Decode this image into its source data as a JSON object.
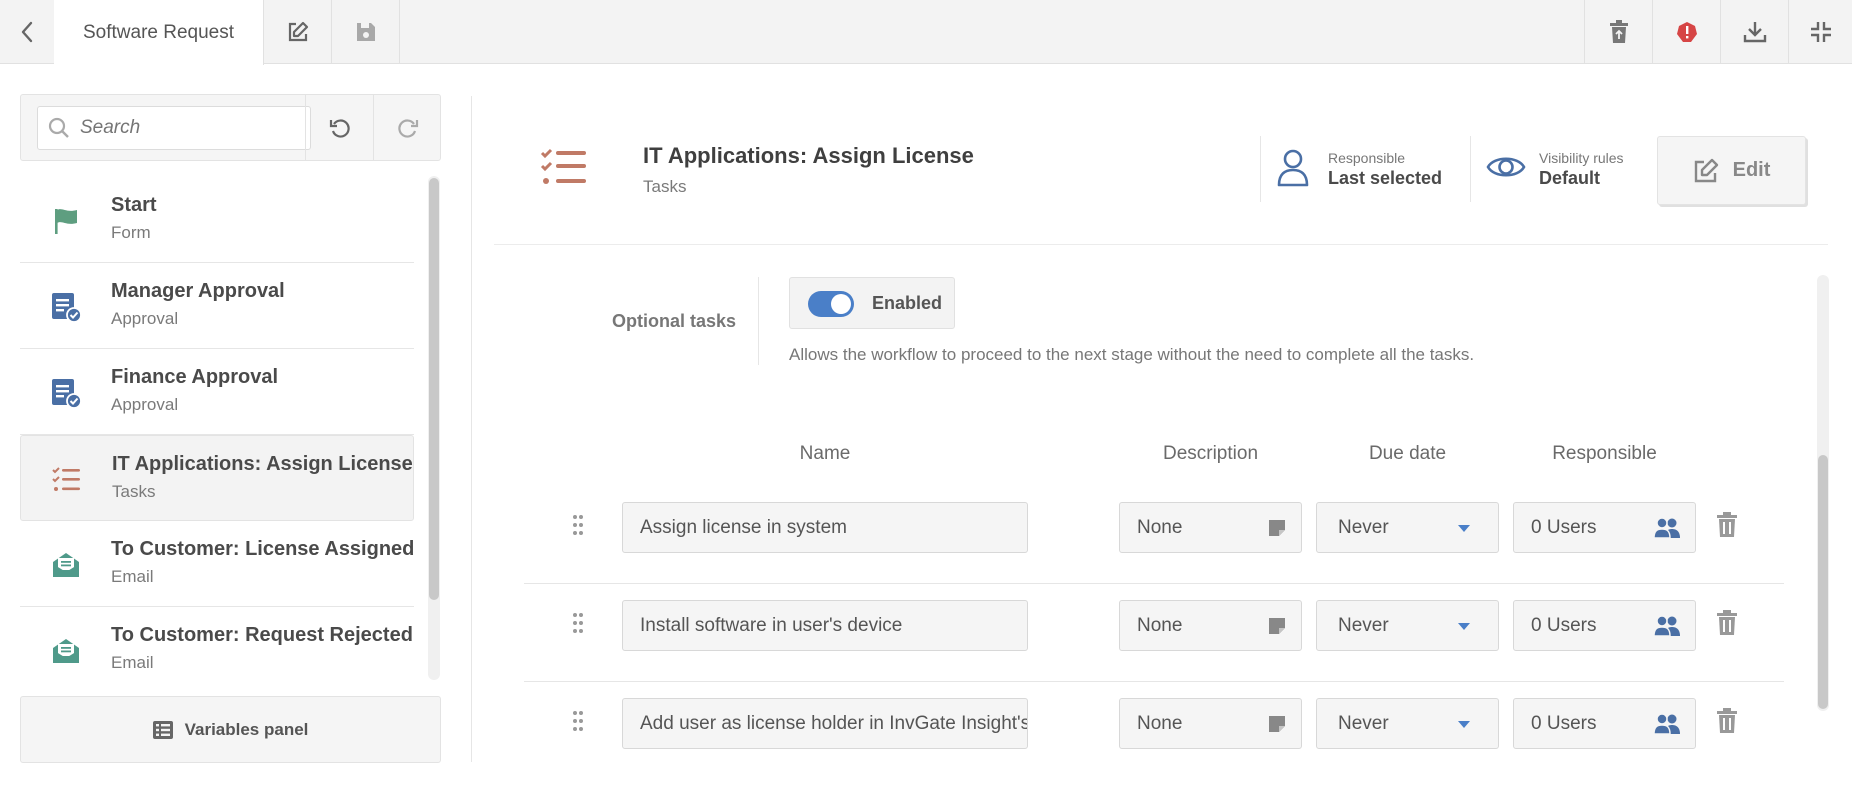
{
  "topbar": {
    "tab_title": "Software Request"
  },
  "search": {
    "placeholder": "Search"
  },
  "stages": [
    {
      "name": "Start",
      "type": "Form",
      "icon": "flag-icon",
      "color": "#5e9e80"
    },
    {
      "name": "Manager Approval",
      "type": "Approval",
      "icon": "approval-icon",
      "color": "#4a6fa5"
    },
    {
      "name": "Finance Approval",
      "type": "Approval",
      "icon": "approval-icon",
      "color": "#4a6fa5"
    },
    {
      "name": "IT Applications: Assign License",
      "type": "Tasks",
      "icon": "tasks-icon",
      "color": "#c07a66",
      "active": true
    },
    {
      "name": "To Customer: License Assigned",
      "type": "Email",
      "icon": "email-icon",
      "color": "#4f9a8a"
    },
    {
      "name": "To Customer: Request Rejected",
      "type": "Email",
      "icon": "email-icon",
      "color": "#4f9a8a"
    }
  ],
  "variables_panel_label": "Variables panel",
  "header": {
    "title": "IT Applications: Assign License",
    "subtitle": "Tasks",
    "responsible_label": "Responsible",
    "responsible_value": "Last selected",
    "visibility_label": "Visibility rules",
    "visibility_value": "Default",
    "edit_label": "Edit"
  },
  "optional_tasks": {
    "label": "Optional tasks",
    "toggle_label": "Enabled",
    "enabled": true,
    "description": "Allows the workflow to proceed to the next stage without the need to complete all the tasks."
  },
  "table": {
    "columns": [
      "Name",
      "Description",
      "Due date",
      "Responsible"
    ],
    "rows": [
      {
        "name": "Assign license in system",
        "description": "None",
        "due": "Never",
        "responsible": "0 Users"
      },
      {
        "name": "Install software in user's device",
        "description": "None",
        "due": "Never",
        "responsible": "0 Users"
      },
      {
        "name": "Add user as license holder in InvGate Insight's contra",
        "description": "None",
        "due": "Never",
        "responsible": "0 Users"
      }
    ]
  },
  "colors": {
    "accent": "#4a7fc8",
    "alert": "#d64545",
    "tasks": "#c07a66"
  }
}
